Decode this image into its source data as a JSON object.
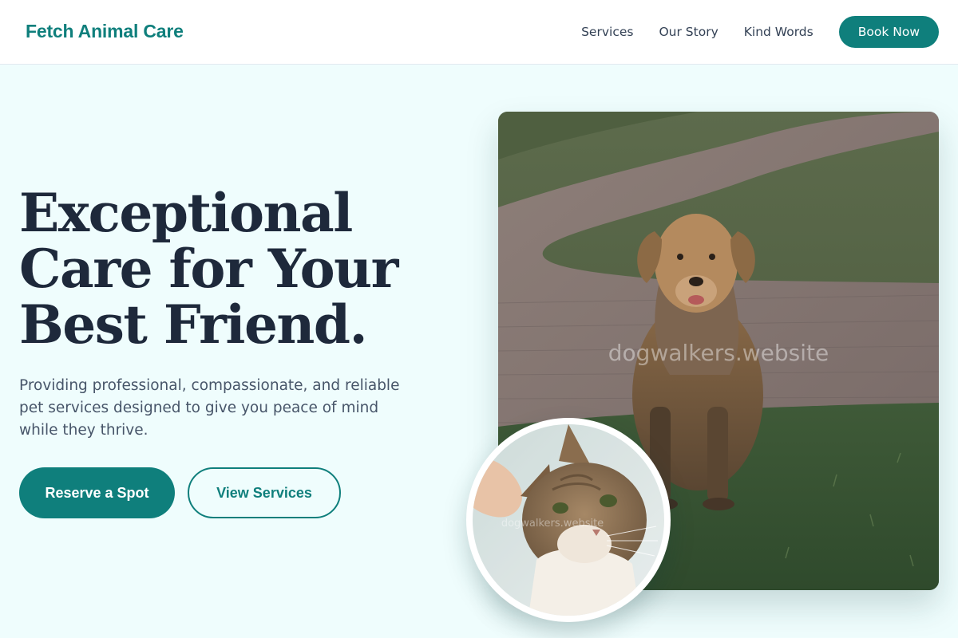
{
  "header": {
    "brand": "Fetch Animal Care",
    "nav": {
      "services": "Services",
      "our_story": "Our Story",
      "kind_words": "Kind Words",
      "book_now": "Book Now"
    }
  },
  "hero": {
    "title_line1": "Exceptional",
    "title_line2": "Care for Your",
    "title_line3": "Best Friend.",
    "subtitle": "Providing professional, compassionate, and reliable pet services designed to give you peace of mind while they thrive.",
    "primary_button": "Reserve a Spot",
    "secondary_button": "View Services"
  },
  "images": {
    "main_alt": "Dog sitting on grass beside a brick path",
    "inset_alt": "Tabby cat being petted",
    "watermark": "dogwalkers.website"
  },
  "colors": {
    "brand": "#0f7f7c",
    "background": "#effdfd",
    "heading": "#1e293b",
    "body_text": "#475569"
  }
}
